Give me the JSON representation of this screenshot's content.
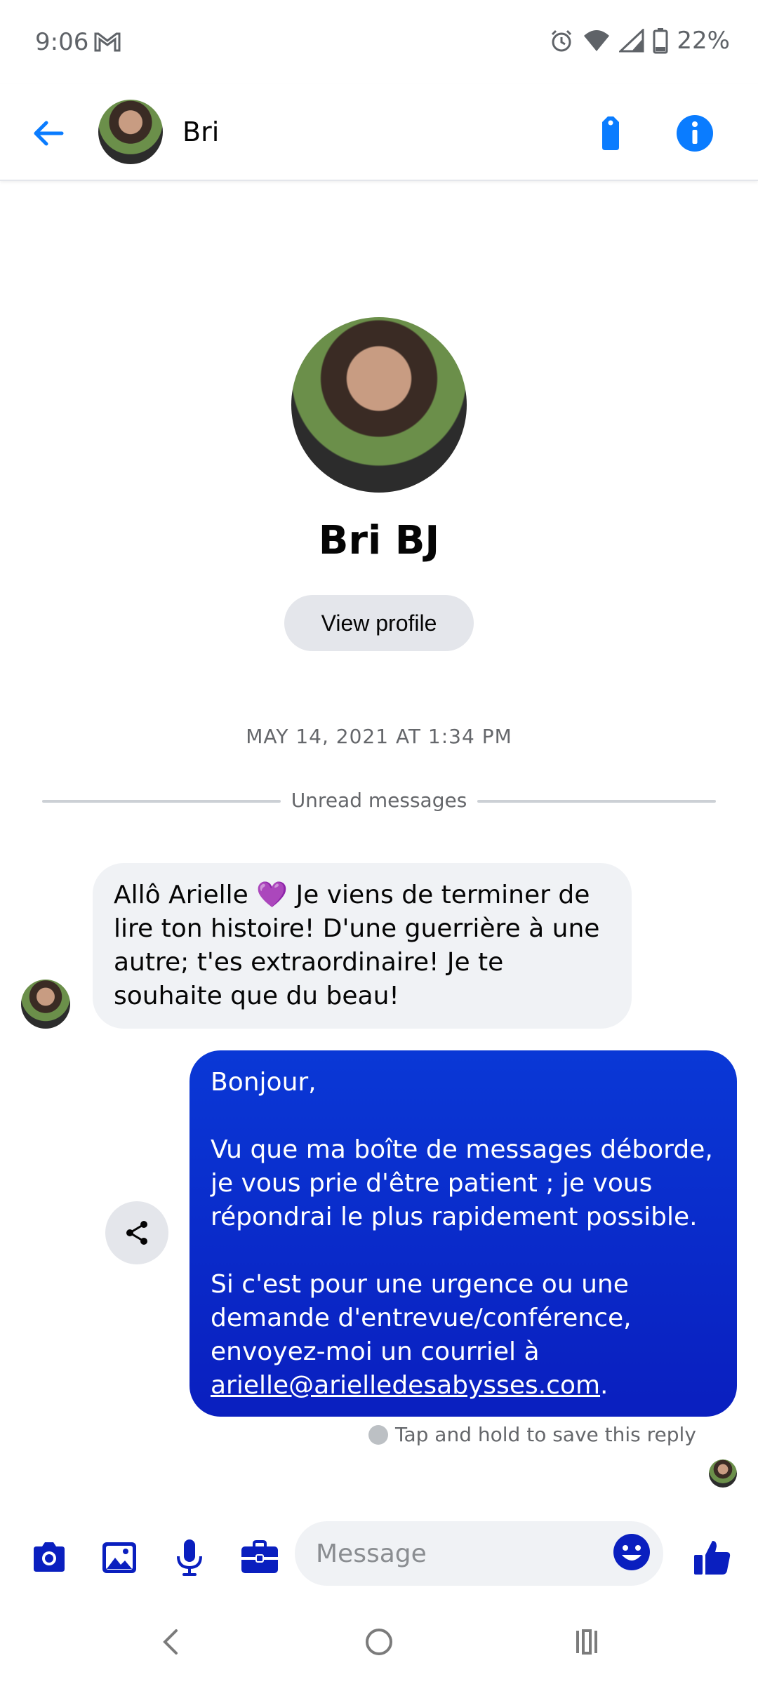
{
  "status_bar": {
    "time": "9:06",
    "battery": "22%"
  },
  "header": {
    "contact_name": "Bri"
  },
  "profile": {
    "name": "Bri BJ",
    "view_profile_label": "View profile"
  },
  "conversation": {
    "timestamp": "MAY 14, 2021 AT 1:34 PM",
    "unread_label": "Unread messages",
    "incoming_message": "Allô Arielle 💜 Je viens de terminer de lire ton histoire! D'une guerrière à une autre; t'es extraordinaire! Je te souhaite que du beau!",
    "outgoing_message": {
      "greeting": "Bonjour,",
      "paragraph1": "Vu que ma boîte de messages déborde, je vous prie d'être patient ; je vous répondrai le plus rapidement possible.",
      "paragraph2": "Si c'est pour une urgence ou une demande d'entrevue/conférence, envoyez-moi un courriel à",
      "email": "arielle@arielledesabysses.com",
      "period": "."
    },
    "save_hint": "Tap and hold to save this reply"
  },
  "composer": {
    "placeholder": "Message"
  },
  "colors": {
    "accent": "#0a7cff",
    "icon_blue": "#0a1fbf",
    "outgoing_bubble": "#0a2ccc",
    "incoming_bubble": "#f0f2f5"
  },
  "icons": {
    "back": "arrow-left-icon",
    "tag": "tag-icon",
    "info": "info-icon",
    "share": "share-icon",
    "camera": "camera-icon",
    "gallery": "image-icon",
    "mic": "microphone-icon",
    "briefcase": "briefcase-icon",
    "emoji": "emoji-icon",
    "like": "thumbs-up-icon"
  }
}
